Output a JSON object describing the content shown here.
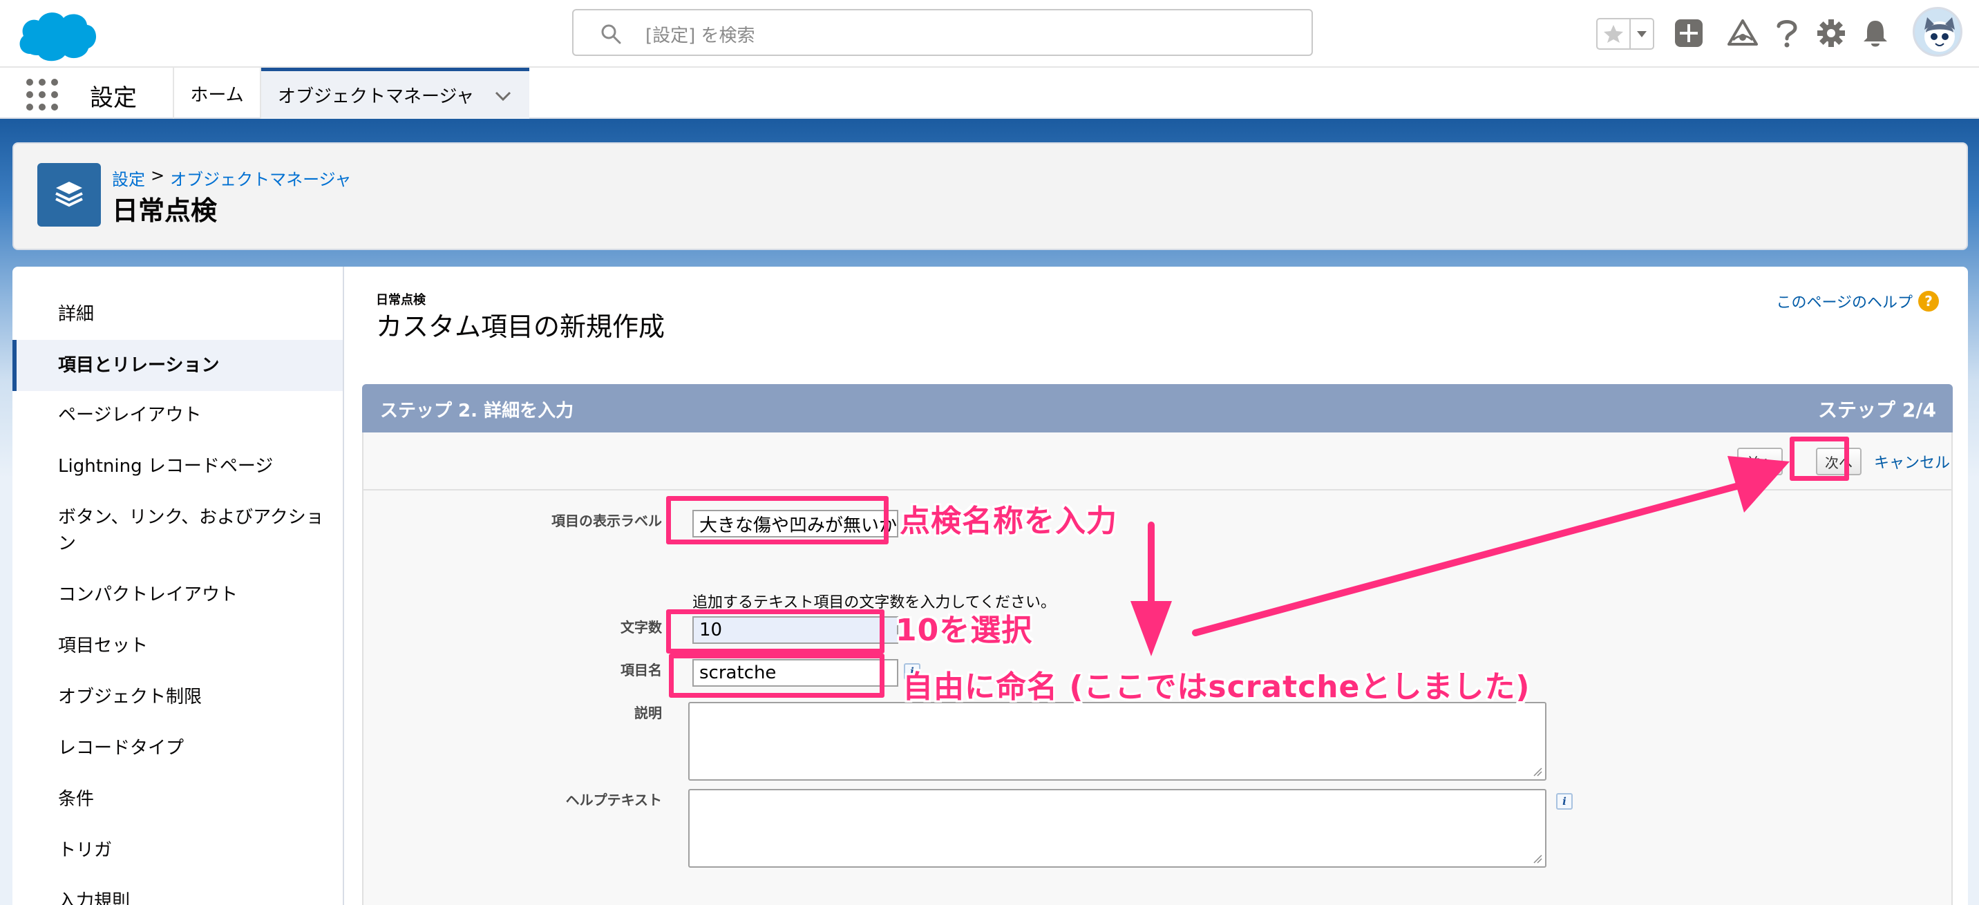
{
  "header": {
    "search_placeholder": "[設定] を検索",
    "icons": [
      "salesforce-cloud-logo",
      "search-icon",
      "star-icon",
      "chevron-down-icon",
      "add-icon",
      "trailhead-icon",
      "help-icon",
      "gear-icon",
      "bell-icon",
      "avatar"
    ]
  },
  "nav": {
    "app_name": "設定",
    "tabs": [
      {
        "label": "ホーム"
      },
      {
        "label": "オブジェクトマネージャ"
      }
    ]
  },
  "page_header": {
    "breadcrumb": {
      "root": "設定",
      "sep": ">",
      "child": "オブジェクトマネージャ"
    },
    "title": "日常点検"
  },
  "sidebar": {
    "items": [
      {
        "label": "詳細"
      },
      {
        "label": "項目とリレーション"
      },
      {
        "label": "ページレイアウト"
      },
      {
        "label": "Lightning レコードページ"
      },
      {
        "label": "ボタン、リンク、およびアクショ"
      },
      {
        "label": "ン"
      },
      {
        "label": "コンパクトレイアウト"
      },
      {
        "label": "項目セット"
      },
      {
        "label": "オブジェクト制限"
      },
      {
        "label": "レコードタイプ"
      },
      {
        "label": "条件"
      },
      {
        "label": "トリガ"
      },
      {
        "label": "入力規則"
      }
    ]
  },
  "main": {
    "object_label": "日常点検",
    "title": "カスタム項目の新規作成",
    "help_link": "このページのヘルプ",
    "help_badge": "?",
    "step_title": "ステップ 2. 詳細を入力",
    "step_counter": "ステップ 2/4",
    "buttons": {
      "prev": "前へ",
      "next": "次へ",
      "cancel": "キャンセル"
    },
    "form": {
      "field_label_label": "項目の表示ラベル",
      "field_label_value": "大きな傷や凹みが無いか",
      "length_hint": "追加するテキスト項目の文字数を入力してください。",
      "length_label": "文字数",
      "length_value": "10",
      "field_name_label": "項目名",
      "field_name_value": "scratche",
      "description_label": "説明",
      "help_text_label": "ヘルプテキスト",
      "info_glyph": "i"
    }
  },
  "annotations": {
    "label_note": "点検名称を入力",
    "length_note": "10を選択",
    "name_note": "自由に命名 (ここではscratcheとしました)",
    "accent_color": "#ff2e7e"
  }
}
